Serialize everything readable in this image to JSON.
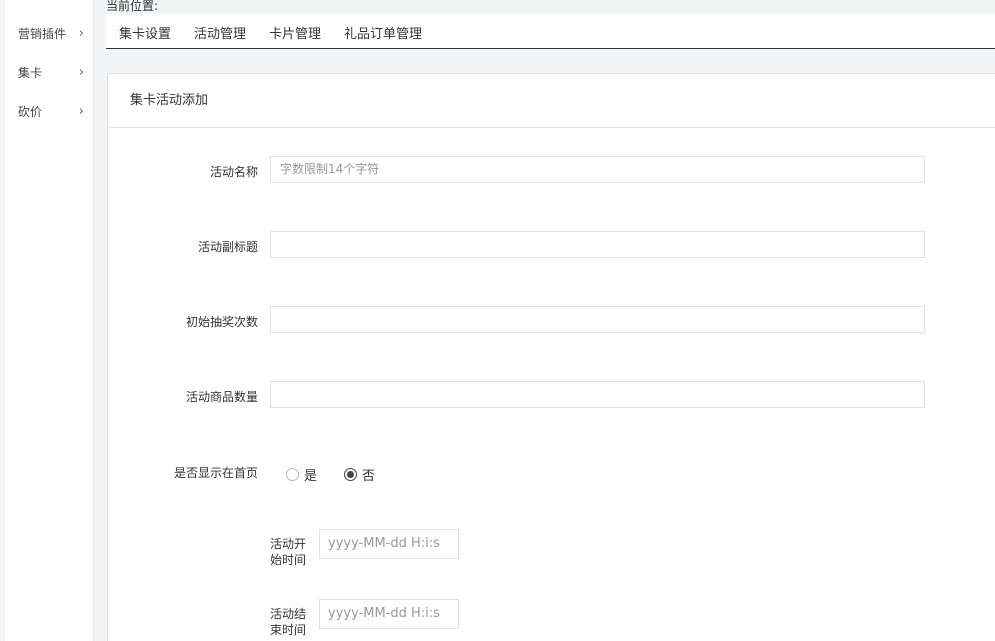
{
  "sidebar": {
    "items": [
      {
        "label": "营销插件",
        "chevron": "›"
      },
      {
        "label": "集卡",
        "chevron": "›"
      },
      {
        "label": "砍价",
        "chevron": "›"
      }
    ]
  },
  "breadcrumb": "当前位置:",
  "tabs": [
    "集卡设置",
    "活动管理",
    "卡片管理",
    "礼品订单管理"
  ],
  "card": {
    "title": "集卡活动添加",
    "fields": {
      "name_label": "活动名称",
      "name_placeholder": "字数限制14个字符",
      "subtitle_label": "活动副标题",
      "initial_draws_label": "初始抽奖次数",
      "goods_count_label": "活动商品数量",
      "show_home_label": "是否显示在首页",
      "show_home_options": [
        "是",
        "否"
      ],
      "show_home_selected": "否",
      "start_time_label": "活动开始时间",
      "start_time_label_lines": [
        "活动开",
        "始时间"
      ],
      "start_time_placeholder": "yyyy-MM-dd H:i:s",
      "end_time_label": "活动结束时间",
      "end_time_label_lines": [
        "活动结",
        "束时间"
      ],
      "end_time_placeholder": "yyyy-MM-dd H:i:s"
    }
  }
}
